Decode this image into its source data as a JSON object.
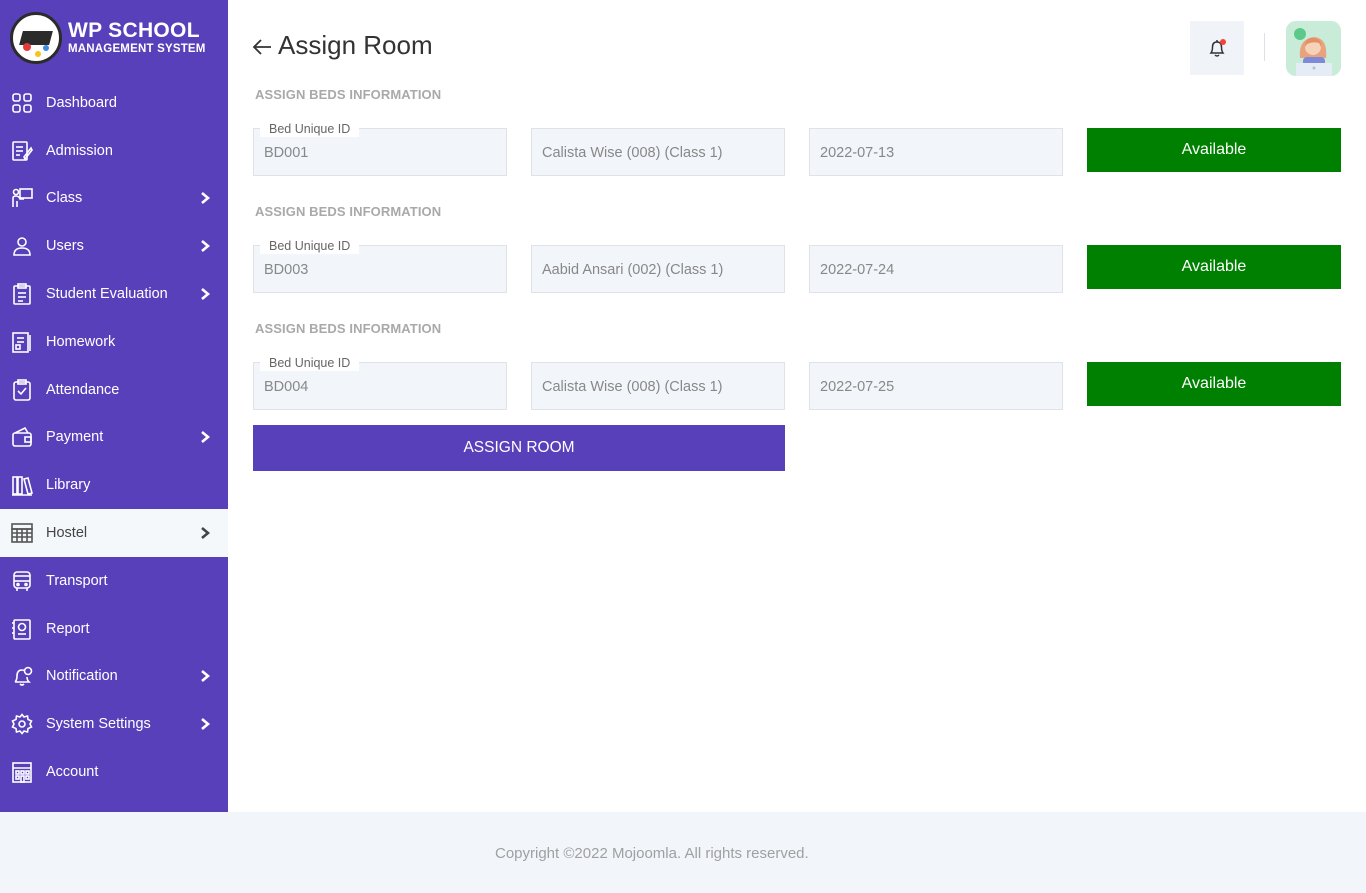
{
  "logo": {
    "title": "WP SCHOOL",
    "subtitle": "MANAGEMENT SYSTEM"
  },
  "sidebar": {
    "items": [
      {
        "label": "Dashboard",
        "icon": "grid-icon",
        "has_submenu": false,
        "active": false
      },
      {
        "label": "Admission",
        "icon": "edit-document-icon",
        "has_submenu": false,
        "active": false
      },
      {
        "label": "Class",
        "icon": "teacher-board-icon",
        "has_submenu": true,
        "active": false
      },
      {
        "label": "Users",
        "icon": "user-icon",
        "has_submenu": true,
        "active": false
      },
      {
        "label": "Student Evaluation",
        "icon": "clipboard-list-icon",
        "has_submenu": true,
        "active": false
      },
      {
        "label": "Homework",
        "icon": "notebook-icon",
        "has_submenu": false,
        "active": false
      },
      {
        "label": "Attendance",
        "icon": "clipboard-check-icon",
        "has_submenu": false,
        "active": false
      },
      {
        "label": "Payment",
        "icon": "wallet-icon",
        "has_submenu": true,
        "active": false
      },
      {
        "label": "Library",
        "icon": "books-icon",
        "has_submenu": false,
        "active": false
      },
      {
        "label": "Hostel",
        "icon": "hostel-building-icon",
        "has_submenu": true,
        "active": true
      },
      {
        "label": "Transport",
        "icon": "bus-icon",
        "has_submenu": false,
        "active": false
      },
      {
        "label": "Report",
        "icon": "report-icon",
        "has_submenu": false,
        "active": false
      },
      {
        "label": "Notification",
        "icon": "bell-alert-icon",
        "has_submenu": true,
        "active": false
      },
      {
        "label": "System Settings",
        "icon": "gear-icon",
        "has_submenu": true,
        "active": false
      },
      {
        "label": "Account",
        "icon": "account-building-icon",
        "has_submenu": false,
        "active": false
      }
    ]
  },
  "header": {
    "title": "Assign Room"
  },
  "sections": [
    {
      "title": "ASSIGN BEDS INFORMATION",
      "bed_label": "Bed Unique ID",
      "bed_id": "BD001",
      "student": "Calista Wise (008) (Class 1)",
      "date": "2022-07-13",
      "status": "Available"
    },
    {
      "title": "ASSIGN BEDS INFORMATION",
      "bed_label": "Bed Unique ID",
      "bed_id": "BD003",
      "student": "Aabid Ansari (002) (Class 1)",
      "date": "2022-07-24",
      "status": "Available"
    },
    {
      "title": "ASSIGN BEDS INFORMATION",
      "bed_label": "Bed Unique ID",
      "bed_id": "BD004",
      "student": "Calista Wise (008) (Class 1)",
      "date": "2022-07-25",
      "status": "Available"
    }
  ],
  "assign_button": "ASSIGN ROOM",
  "footer": {
    "text": "Copyright ©2022 Mojoomla. All rights reserved."
  },
  "colors": {
    "sidebar": "#5840bb",
    "status_available": "#008000",
    "footer_bg": "#f2f5fa"
  }
}
